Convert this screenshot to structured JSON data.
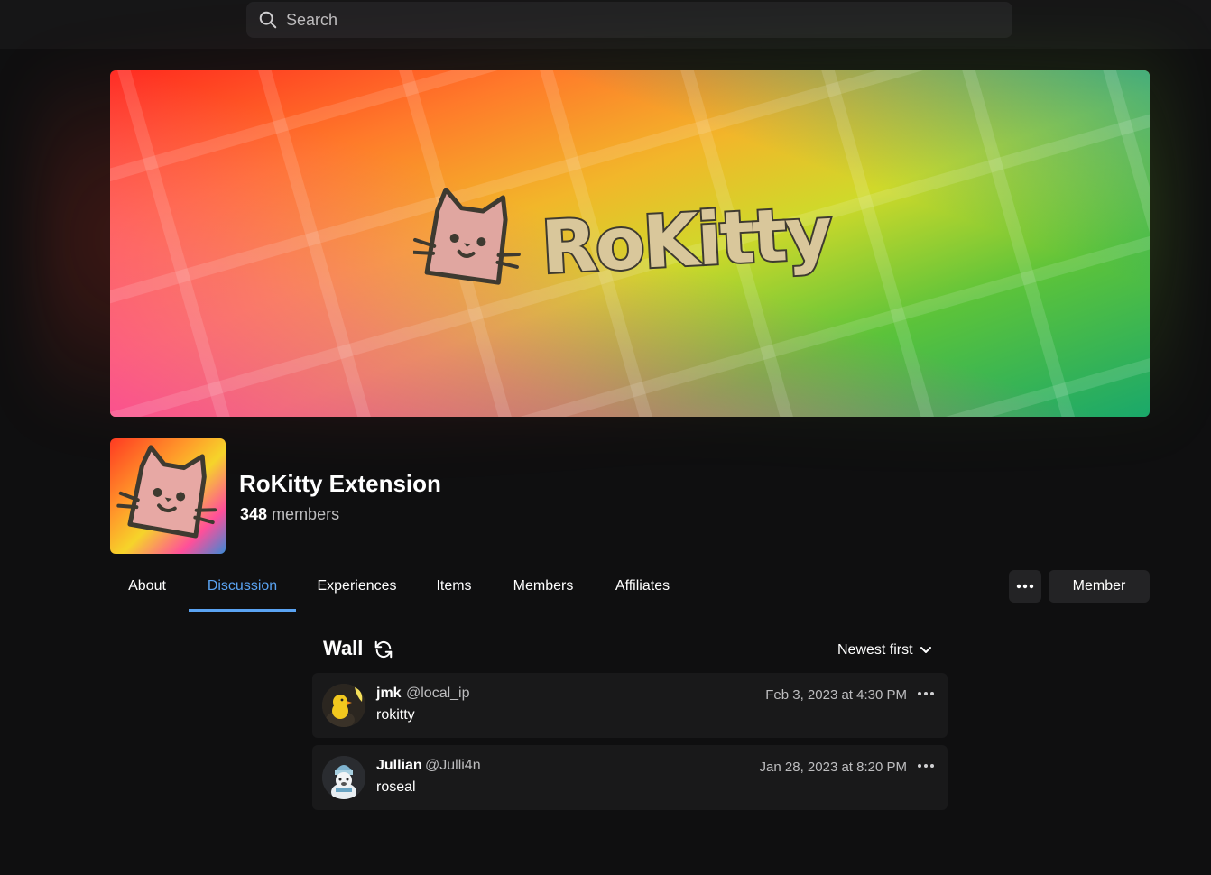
{
  "search": {
    "placeholder": "Search"
  },
  "banner": {
    "wordmark": "RoKitty"
  },
  "group": {
    "name": "RoKitty Extension",
    "member_count": "348",
    "member_suffix": "members"
  },
  "tabs": [
    {
      "label": "About"
    },
    {
      "label": "Discussion",
      "active": true
    },
    {
      "label": "Experiences"
    },
    {
      "label": "Items"
    },
    {
      "label": "Members"
    },
    {
      "label": "Affiliates"
    }
  ],
  "actions": {
    "member_label": "Member"
  },
  "wall": {
    "title": "Wall",
    "sort_label": "Newest first",
    "posts": [
      {
        "display_name": "jmk",
        "username": "@local_ip",
        "timestamp": "Feb 3, 2023 at 4:30 PM",
        "body": "rokitty"
      },
      {
        "display_name": "Jullian",
        "username": "@Julli4n",
        "timestamp": "Jan 28, 2023 at 8:20 PM",
        "body": "roseal"
      }
    ]
  },
  "colors": {
    "accent": "#5aa3f2",
    "background": "#0f0f10",
    "card": "#19191a"
  }
}
